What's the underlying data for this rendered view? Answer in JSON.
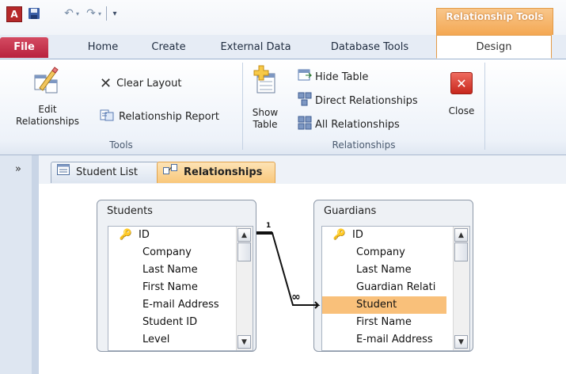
{
  "app": {
    "logo_letter": "A"
  },
  "contextual_tab": {
    "label": "Relationship Tools"
  },
  "tabs": [
    {
      "label": "File"
    },
    {
      "label": "Home"
    },
    {
      "label": "Create"
    },
    {
      "label": "External Data"
    },
    {
      "label": "Database Tools"
    },
    {
      "label": "Design"
    }
  ],
  "ribbon": {
    "tools": {
      "label": "Tools",
      "edit_relationships_line1": "Edit",
      "edit_relationships_line2": "Relationships",
      "clear_layout": "Clear Layout",
      "relationship_report": "Relationship Report"
    },
    "relationships": {
      "label": "Relationships",
      "show_table_line1": "Show",
      "show_table_line2": "Table",
      "hide_table": "Hide Table",
      "direct_relationships": "Direct Relationships",
      "all_relationships": "All Relationships",
      "close": "Close"
    }
  },
  "nav": {
    "toggle": "»"
  },
  "doc_tabs": [
    {
      "label": "Student List"
    },
    {
      "label": "Relationships"
    }
  ],
  "tables": {
    "students": {
      "title": "Students",
      "fields": [
        "ID",
        "Company",
        "Last Name",
        "First Name",
        "E-mail Address",
        "Student ID",
        "Level"
      ]
    },
    "guardians": {
      "title": "Guardians",
      "fields": [
        "ID",
        "Company",
        "Last Name",
        "Guardian Relati",
        "Student",
        "First Name",
        "E-mail Address"
      ],
      "selected": "Student"
    }
  },
  "relationship": {
    "one_side": "1",
    "many_side": "∞"
  }
}
